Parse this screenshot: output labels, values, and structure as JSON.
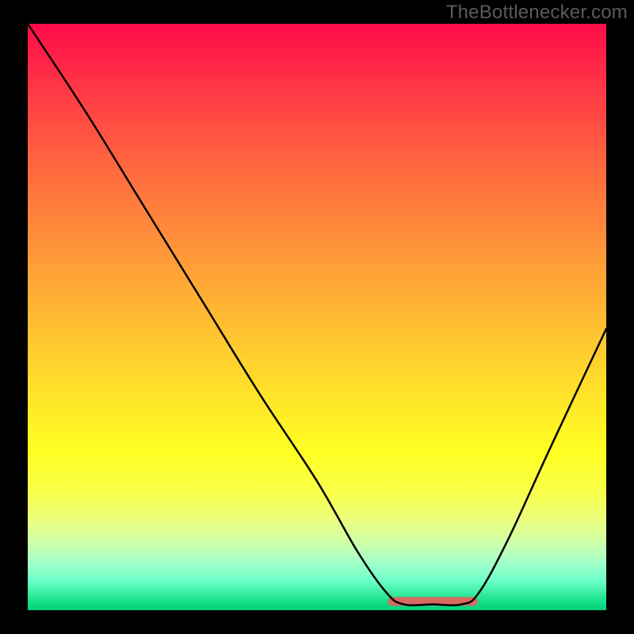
{
  "watermark": "TheBottlenecker.com",
  "chart_data": {
    "type": "line",
    "title": "",
    "xlabel": "",
    "ylabel": "",
    "xlim": [
      0,
      100
    ],
    "ylim": [
      0,
      100
    ],
    "grid": false,
    "legend": false,
    "background": {
      "kind": "vertical-gradient",
      "stops": [
        {
          "pos": 0,
          "color": "#ff0b49"
        },
        {
          "pos": 25,
          "color": "#ff6a3f"
        },
        {
          "pos": 50,
          "color": "#ffbb33"
        },
        {
          "pos": 73,
          "color": "#ffff22"
        },
        {
          "pos": 92,
          "color": "#a0ffc8"
        },
        {
          "pos": 100,
          "color": "#00cf78"
        }
      ]
    },
    "series": [
      {
        "name": "bottleneck-curve",
        "color": "#000000",
        "points": [
          {
            "x": 0,
            "y": 100
          },
          {
            "x": 10,
            "y": 85
          },
          {
            "x": 20,
            "y": 69
          },
          {
            "x": 30,
            "y": 53
          },
          {
            "x": 40,
            "y": 37
          },
          {
            "x": 50,
            "y": 22
          },
          {
            "x": 57,
            "y": 10
          },
          {
            "x": 62,
            "y": 3
          },
          {
            "x": 65,
            "y": 1
          },
          {
            "x": 70,
            "y": 1
          },
          {
            "x": 75,
            "y": 1
          },
          {
            "x": 78,
            "y": 3
          },
          {
            "x": 83,
            "y": 12
          },
          {
            "x": 90,
            "y": 27
          },
          {
            "x": 100,
            "y": 48
          }
        ]
      }
    ],
    "optimal_range": {
      "name": "optimal-flat-segment",
      "color": "#d86a5f",
      "x_start": 63,
      "x_end": 77,
      "y": 1.5
    }
  }
}
